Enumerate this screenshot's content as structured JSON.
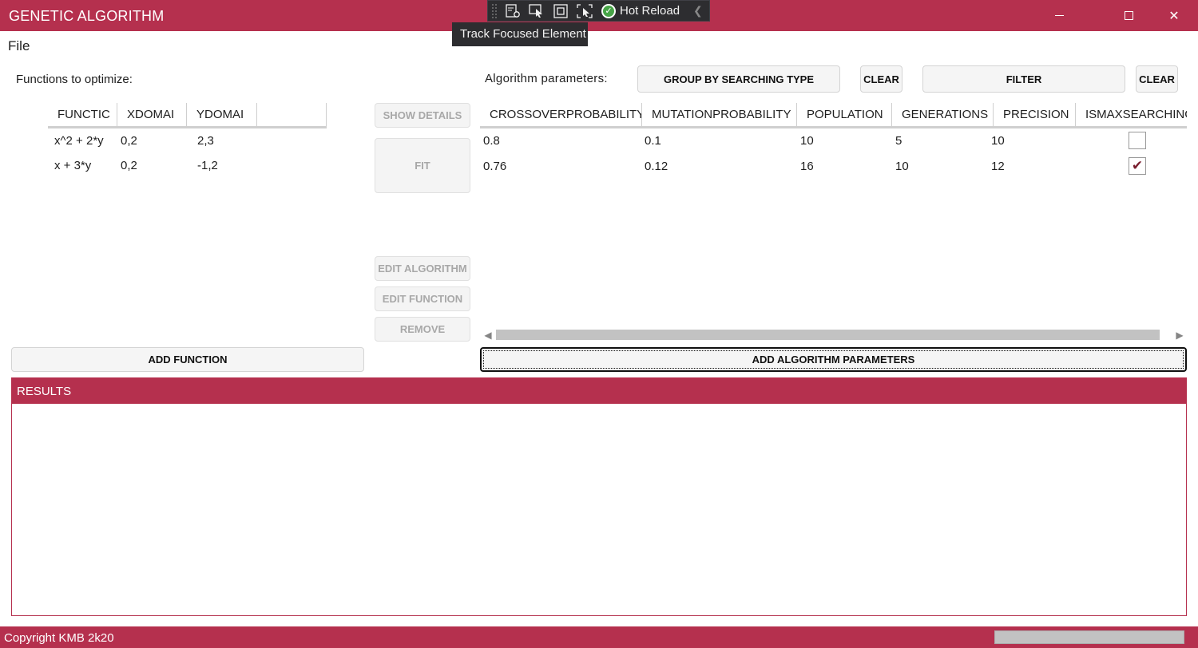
{
  "window": {
    "title": "GENETIC ALGORITHM"
  },
  "dev_toolbar": {
    "icons": [
      "live-visual-tree-icon",
      "select-element-icon",
      "display-layout-adorners-icon",
      "track-focused-element-icon",
      "hot-reload-check-icon",
      "collapse-chevron-icon"
    ],
    "hot_reload_label": "Hot Reload",
    "tooltip": "Track Focused Element"
  },
  "menu": {
    "file": "File"
  },
  "functions": {
    "heading": "Functions to optimize:",
    "columns": [
      "FUNCTIC",
      "XDOMAI",
      "YDOMAI",
      ""
    ],
    "rows": [
      [
        "x^2 + 2*y",
        "0,2",
        "2,3"
      ],
      [
        "x + 3*y",
        "0,2",
        "-1,2"
      ]
    ],
    "add_button": "ADD FUNCTION"
  },
  "middle_buttons": {
    "show_details": "SHOW DETAILS",
    "fit": "FIT",
    "edit_algorithm": "EDIT ALGORITHM",
    "edit_function": "EDIT FUNCTION",
    "remove": "REMOVE"
  },
  "algorithm": {
    "heading": "Algorithm parameters:",
    "group_button": "GROUP BY SEARCHING TYPE",
    "clear_group_button": "CLEAR",
    "filter_button": "FILTER",
    "clear_filter_button": "CLEAR",
    "columns": [
      "CROSSOVERPROBABILITY",
      "MUTATIONPROBABILITY",
      "POPULATION",
      "GENERATIONS",
      "PRECISION",
      "ISMAXSEARCHING"
    ],
    "rows": [
      [
        "0.8",
        "0.1",
        "10",
        "5",
        "10"
      ],
      [
        "0.76",
        "0.12",
        "16",
        "10",
        "12"
      ]
    ],
    "is_max_searching": [
      false,
      true
    ],
    "add_button": "ADD ALGORITHM PARAMETERS"
  },
  "results": {
    "heading": "RESULTS"
  },
  "status": {
    "copyright": "Copyright KMB 2k20",
    "progress": 0
  },
  "colors": {
    "accent": "#b5304e",
    "check": "#7a1f2f"
  }
}
